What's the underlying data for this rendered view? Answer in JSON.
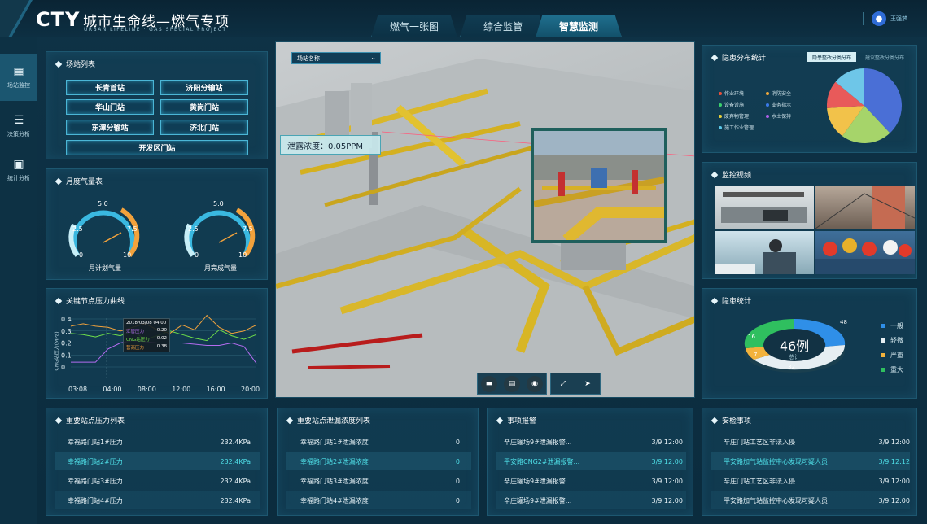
{
  "header": {
    "logo": "CTY",
    "title": "城市生命线—燃气专项",
    "subtitle": "URBAN LIFELINE · GAS SPECIAL PROJECT",
    "user": "王强梦"
  },
  "nav": {
    "tabs": [
      {
        "label": "燃气一张图",
        "active": false
      },
      {
        "label": "综合监管",
        "active": false
      },
      {
        "label": "智慧监测",
        "active": true
      }
    ]
  },
  "sidebar": {
    "items": [
      {
        "label": "场站监控",
        "icon": "grid-icon",
        "active": true
      },
      {
        "label": "决策分析",
        "icon": "layers-icon",
        "active": false
      },
      {
        "label": "统计分析",
        "icon": "stats-icon",
        "active": false
      }
    ]
  },
  "stations": {
    "title": "场站列表",
    "items": [
      "长青首站",
      "济阳分输站",
      "华山门站",
      "黄岗门站",
      "东潭分输站",
      "济北门站",
      "开发区门站"
    ]
  },
  "gauges": {
    "title": "月度气量表",
    "left_label": "月计划气量",
    "right_label": "月完成气量",
    "ticks": [
      "0",
      "2.5",
      "5.0",
      "7.5",
      "10"
    ],
    "values": [
      7.5,
      7.5
    ]
  },
  "pressure_curve": {
    "title": "关键节点压力曲线",
    "ylabel": "CNG站压力(MPa)",
    "tooltip": {
      "time": "2018/03/08 04:00",
      "rows": [
        {
          "label": "汇管压力",
          "value": "0.20",
          "color": "#b46cf0"
        },
        {
          "label": "CNG站压力",
          "value": "0.02",
          "color": "#6fe04a"
        },
        {
          "label": "营商压力",
          "value": "0.38",
          "color": "#f2a23c"
        }
      ]
    }
  },
  "chart_data": {
    "type": "line",
    "x": [
      "03:08",
      "04:00",
      "08:00",
      "12:00",
      "16:00",
      "20:00"
    ],
    "yticks": [
      "0",
      "0.1",
      "0.2",
      "0.3",
      "0.4"
    ],
    "ylim": [
      0,
      0.4
    ],
    "ylabel": "CNG站压力(MPa)",
    "series": [
      {
        "name": "汇管压力",
        "color": "#b46cf0",
        "values": [
          0.04,
          0.04,
          0.04,
          0.15,
          0.2,
          0.22,
          0.21,
          0.2,
          0.2,
          0.2,
          0.19,
          0.18,
          0.18,
          0.2,
          0.17,
          0.03
        ]
      },
      {
        "name": "CNG站压力",
        "color": "#6fe04a",
        "values": [
          0.28,
          0.27,
          0.25,
          0.28,
          0.26,
          0.3,
          0.23,
          0.26,
          0.3,
          0.27,
          0.24,
          0.22,
          0.31,
          0.26,
          0.23,
          0.27
        ]
      },
      {
        "name": "营商压力",
        "color": "#f2a23c",
        "values": [
          0.34,
          0.36,
          0.34,
          0.33,
          0.3,
          0.33,
          0.36,
          0.31,
          0.28,
          0.35,
          0.31,
          0.43,
          0.33,
          0.28,
          0.3,
          0.35
        ]
      }
    ]
  },
  "center": {
    "station_select": "场站名称",
    "leak_text": "泄露浓度：0.05PPM"
  },
  "hazard_dist": {
    "title": "隐患分布统计",
    "tabs": [
      "隐患整改分类分布",
      "建议整改分类分布"
    ],
    "legend": [
      {
        "label": "作业环境",
        "color": "#e8503a"
      },
      {
        "label": "消防安全",
        "color": "#f0a83c"
      },
      {
        "label": "设备设施",
        "color": "#3ad06c"
      },
      {
        "label": "业务指示",
        "color": "#3a7ae8"
      },
      {
        "label": "废弃物管理",
        "color": "#e8d03a"
      },
      {
        "label": "水土保持",
        "color": "#b060e8"
      },
      {
        "label": "施工作业管理",
        "color": "#5ac8e8"
      }
    ],
    "pie": [
      {
        "value": 38,
        "color": "#4a6fd6"
      },
      {
        "value": 22,
        "color": "#a6d46a"
      },
      {
        "value": 14,
        "color": "#f2c24a"
      },
      {
        "value": 12,
        "color": "#e85a5a"
      },
      {
        "value": 14,
        "color": "#6ec6e8"
      }
    ]
  },
  "video": {
    "title": "监控视频"
  },
  "hazard_stats": {
    "title": "隐患统计",
    "total": "46例",
    "total_label": "总计",
    "segments": [
      {
        "label": "一般",
        "value": "48",
        "color": "#2f8fe8"
      },
      {
        "label": "轻微",
        "value": "32",
        "color": "#e6eef2"
      },
      {
        "label": "严重",
        "value": "7",
        "color": "#f2b23c"
      },
      {
        "label": "重大",
        "value": "16",
        "color": "#2fbf5f"
      }
    ]
  },
  "pressure_list": {
    "title": "重要站点压力列表",
    "rows": [
      {
        "name": "幸福路门站1#压力",
        "value": "232.4KPa"
      },
      {
        "name": "幸福路门站2#压力",
        "value": "232.4KPa"
      },
      {
        "name": "幸福路门站3#压力",
        "value": "232.4KPa"
      },
      {
        "name": "幸福路门站4#压力",
        "value": "232.4KPa"
      }
    ]
  },
  "leak_list": {
    "title": "重要站点泄漏浓度列表",
    "rows": [
      {
        "name": "幸福路门站1#泄漏浓度",
        "value": "0"
      },
      {
        "name": "幸福路门站2#泄漏浓度",
        "value": "0"
      },
      {
        "name": "幸福路门站3#泄漏浓度",
        "value": "0"
      },
      {
        "name": "幸福路门站4#泄漏浓度",
        "value": "0"
      }
    ]
  },
  "alarms": {
    "title": "事项报警",
    "rows": [
      {
        "name": "辛庄罐场9#泄漏报警...",
        "time": "3/9  12:00"
      },
      {
        "name": "平安路CNG2#泄漏报警...",
        "time": "3/9  12:00"
      },
      {
        "name": "辛庄罐场9#泄漏报警...",
        "time": "3/9  12:00"
      },
      {
        "name": "辛庄罐场9#泄漏报警...",
        "time": "3/9  12:00"
      }
    ]
  },
  "inspection": {
    "title": "安检事项",
    "rows": [
      {
        "name": "辛庄门站工艺区非法入侵",
        "time": "3/9  12:00"
      },
      {
        "name": "平安路加气站监控中心发现可疑人员",
        "time": "3/9  12:12"
      },
      {
        "name": "辛庄门站工艺区非法入侵",
        "time": "3/9  12:00"
      },
      {
        "name": "平安路加气站监控中心发现可疑人员",
        "time": "3/9  12:00"
      }
    ]
  }
}
